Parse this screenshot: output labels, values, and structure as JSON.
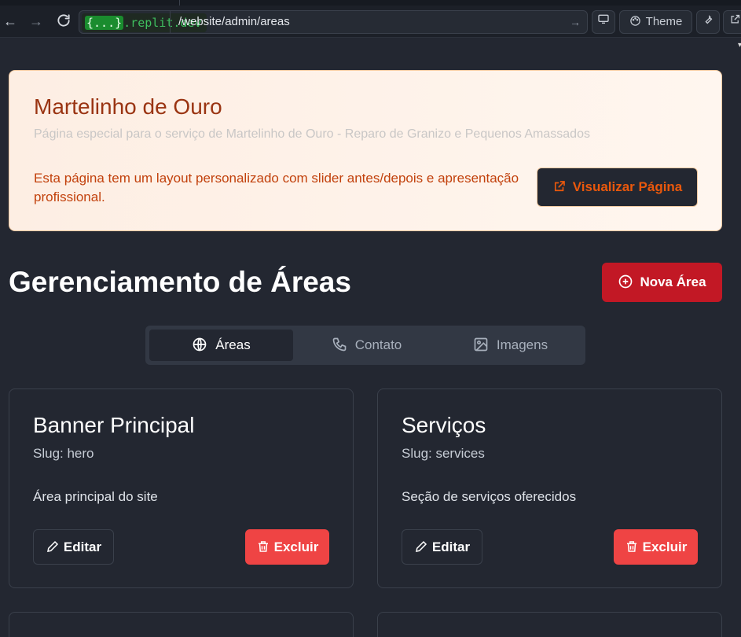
{
  "browser": {
    "domain_brace": "{...}",
    "domain": ".replit.dev",
    "path": "/website/admin/areas",
    "theme_label": "Theme"
  },
  "banner": {
    "title": "Martelinho de Ouro",
    "subtitle": "Página especial para o serviço de Martelinho de Ouro - Reparo de Granizo e Pequenos Amassados",
    "description": "Esta página tem um layout personalizado com slider antes/depois e apresentação profissional.",
    "view_button": "Visualizar Página"
  },
  "header": {
    "title": "Gerenciamento de Áreas",
    "new_button": "Nova Área"
  },
  "tabs": [
    {
      "label": "Áreas",
      "icon": "globe-icon",
      "active": true
    },
    {
      "label": "Contato",
      "icon": "phone-icon",
      "active": false
    },
    {
      "label": "Imagens",
      "icon": "image-icon",
      "active": false
    }
  ],
  "cards": [
    {
      "title": "Banner Principal",
      "slug": "Slug: hero",
      "description": "Área principal do site",
      "edit_label": "Editar",
      "delete_label": "Excluir"
    },
    {
      "title": "Serviços",
      "slug": "Slug: services",
      "description": "Seção de serviços oferecidos",
      "edit_label": "Editar",
      "delete_label": "Excluir"
    }
  ],
  "colors": {
    "background": "#232731",
    "banner_title": "#9a3412",
    "banner_text": "#c2410c",
    "accent_red": "#c21825",
    "delete_red": "#ef4444"
  }
}
